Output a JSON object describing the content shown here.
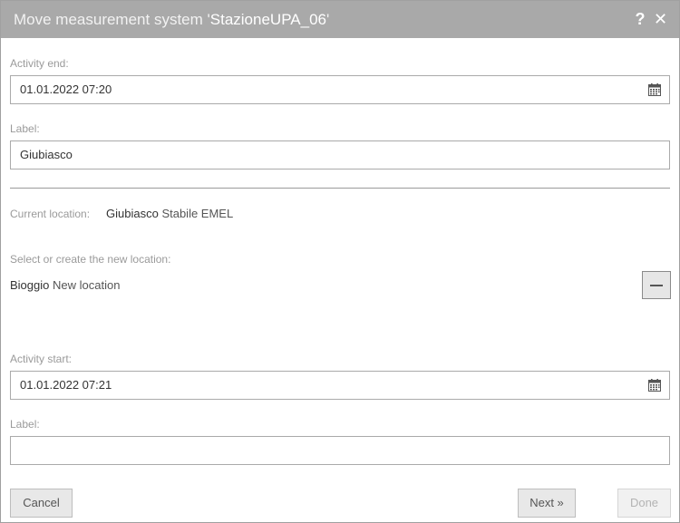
{
  "dialog": {
    "title_prefix": "Move measurement system '",
    "title_name": "StazioneUPA_06",
    "title_suffix": "'",
    "help_icon": "?",
    "close_icon": "✕"
  },
  "activity_end": {
    "label": "Activity end:",
    "value": "01.01.2022 07:20",
    "icon": "calendar-icon"
  },
  "end_label": {
    "label": "Label:",
    "value": "Giubiasco"
  },
  "current_location": {
    "label": "Current location:",
    "name": "Giubiasco",
    "detail": "Stabile EMEL"
  },
  "new_location": {
    "label": "Select or create the new location:",
    "name": "Bioggio",
    "detail": "New location",
    "remove_icon": "minus-icon"
  },
  "activity_start": {
    "label": "Activity start:",
    "value": "01.01.2022 07:21",
    "icon": "calendar-icon"
  },
  "start_label": {
    "label": "Label:",
    "value": ""
  },
  "footer": {
    "cancel": "Cancel",
    "next": "Next »",
    "done": "Done"
  }
}
